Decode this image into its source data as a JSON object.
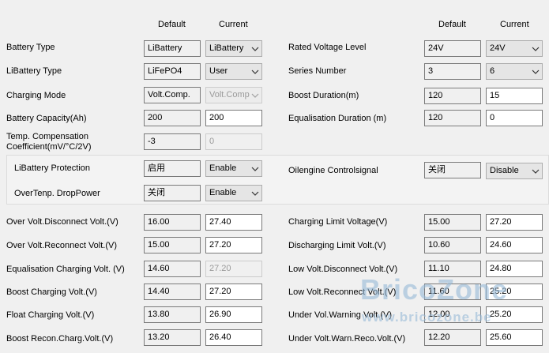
{
  "headers": {
    "default": "Default",
    "current": "Current"
  },
  "top_left": [
    {
      "label": "Battery Type",
      "default": "LiBattery",
      "current": "LiBattery"
    },
    {
      "label": "LiBattery Type",
      "default": "LiFePO4",
      "current": "User"
    },
    {
      "label": "Charging Mode",
      "default": "Volt.Comp.",
      "current": "Volt.Comp"
    },
    {
      "label": "Battery Capacity(Ah)",
      "default": "200",
      "current": "200"
    },
    {
      "label_line1": "Temp. Compensation",
      "label_line2": "Coefficient(mV/°C/2V)",
      "default": "-3",
      "current": "0"
    }
  ],
  "top_right": [
    {
      "label": "Rated Voltage Level",
      "default": "24V",
      "current": "24V"
    },
    {
      "label": "Series Number",
      "default": "3",
      "current": "6"
    },
    {
      "label": "Boost Duration(m)",
      "default": "120",
      "current": "15"
    },
    {
      "label": "Equalisation Duration (m)",
      "default": "120",
      "current": "0"
    }
  ],
  "group": {
    "rows": [
      {
        "label": "LiBattery Protection",
        "default": "启用",
        "current": "Enable"
      },
      {
        "label": "OverTenp. DropPower",
        "default": "关闭",
        "current": "Enable"
      }
    ],
    "right": {
      "label": "Oilengine Controlsignal",
      "default": "关闭",
      "current": "Disable"
    }
  },
  "bottom_left": [
    {
      "label": "Over Volt.Disconnect Volt.(V)",
      "default": "16.00",
      "current": "27.40"
    },
    {
      "label": "Over Volt.Reconnect Volt.(V)",
      "default": "15.00",
      "current": "27.20"
    },
    {
      "label": "Equalisation Charging Volt. (V)",
      "default": "14.60",
      "current": "27.20"
    },
    {
      "label": "Boost Charging Volt.(V)",
      "default": "14.40",
      "current": "27.20"
    },
    {
      "label": "Float Charging Volt.(V)",
      "default": "13.80",
      "current": "26.90"
    },
    {
      "label": "Boost Recon.Charg.Volt.(V)",
      "default": "13.20",
      "current": "26.40"
    }
  ],
  "bottom_right": [
    {
      "label": "Charging Limit Voltage(V)",
      "default": "15.00",
      "current": "27.20"
    },
    {
      "label": "Discharging Limit Volt.(V)",
      "default": "10.60",
      "current": "24.60"
    },
    {
      "label": "Low Volt.Disconnect Volt.(V)",
      "default": "11.10",
      "current": "24.80"
    },
    {
      "label": "Low Volt.Reconnect Volt.(V)",
      "default": "11.60",
      "current": "25.20"
    },
    {
      "label": "Under Vol.Warning Volt.(V)",
      "default": "12.00",
      "current": "25.20"
    },
    {
      "label": "Under Volt.Warn.Reco.Volt.(V)",
      "default": "12.20",
      "current": "25.60"
    }
  ],
  "watermark": {
    "line1": "BricoZone",
    "line2": "www.bricozone.be"
  },
  "icons": {
    "dropdown": "chevron-down-icon"
  },
  "colors": {
    "background": "#f0f0f0",
    "watermark": "#96b9d7"
  }
}
